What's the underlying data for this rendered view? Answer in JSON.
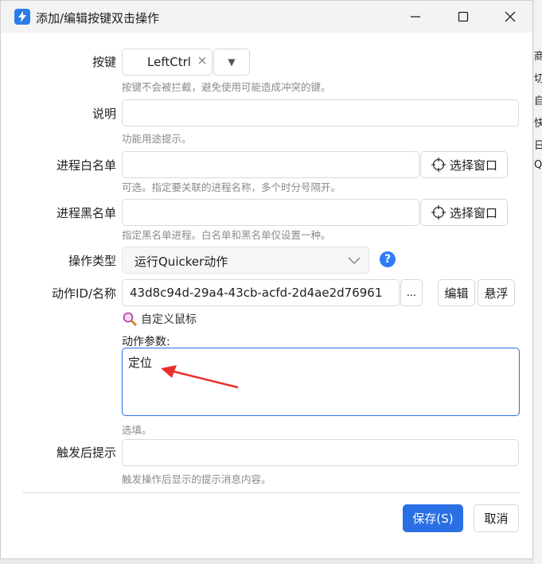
{
  "window": {
    "title": "添加/编辑按键双击操作"
  },
  "background_right_chars": [
    "商",
    "切",
    "自",
    "快",
    "日",
    "Q"
  ],
  "fields": {
    "key": {
      "label": "按键",
      "value": "LeftCtrl",
      "clear_icon": "close-icon",
      "dropdown_glyph": "▼",
      "hint": "按键不会被拦截，避免使用可能造成冲突的键。"
    },
    "description": {
      "label": "说明",
      "value": "",
      "hint": "功能用途提示。"
    },
    "whitelist": {
      "label": "进程白名单",
      "value": "",
      "button": "选择窗口",
      "hint": "可选。指定要关联的进程名称，多个时分号隔开。"
    },
    "blacklist": {
      "label": "进程黑名单",
      "value": "",
      "button": "选择窗口",
      "hint": "指定黑名单进程。白名单和黑名单仅设置一种。"
    },
    "action_type": {
      "label": "操作类型",
      "value": "运行Quicker动作"
    },
    "action_id": {
      "label": "动作ID/名称",
      "value": "43d8c94d-29a4-43cb-acfd-2d4ae2d76961",
      "more": "...",
      "edit": "编辑",
      "float": "悬浮",
      "custom_mouse": "自定义鼠标"
    },
    "action_params": {
      "label": "动作参数:",
      "value": "定位",
      "hint": "选填。"
    },
    "trigger_tip": {
      "label": "触发后提示",
      "value": "",
      "hint": "触发操作后显示的提示消息内容。"
    }
  },
  "footer": {
    "save": "保存(S)",
    "cancel": "取消"
  },
  "colors": {
    "accent": "#2b6fe4",
    "annotation_arrow": "#e8302a",
    "help_icon": "#2e7cf6"
  }
}
